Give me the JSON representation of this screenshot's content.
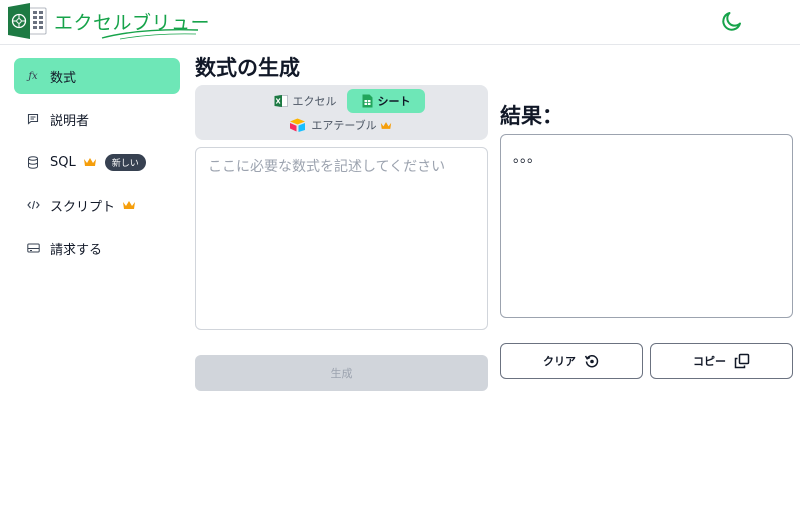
{
  "header": {
    "app_name": "エクセルブリュー",
    "theme_toggle_icon": "moon-icon",
    "brand_color": "#16a34a"
  },
  "sidebar": {
    "items": [
      {
        "label": "数式",
        "icon": "function-icon",
        "active": true
      },
      {
        "label": "説明者",
        "icon": "message-icon"
      },
      {
        "label": "SQL",
        "icon": "database-icon",
        "premium": true,
        "badge": "新しい"
      },
      {
        "label": "スクリプト",
        "icon": "code-icon",
        "premium": true
      },
      {
        "label": "請求する",
        "icon": "billing-icon"
      }
    ]
  },
  "main": {
    "title": "数式の生成",
    "tabs": [
      {
        "label": "エクセル",
        "icon": "excel-icon"
      },
      {
        "label": "シート",
        "icon": "sheets-icon",
        "active": true
      },
      {
        "label": "エアテーブル",
        "icon": "airtable-icon",
        "premium": true
      }
    ],
    "input": {
      "placeholder": "ここに必要な数式を記述してください",
      "value": ""
    },
    "generate_label": "生成"
  },
  "result": {
    "title": "結果：",
    "content": "。。。",
    "clear_label": "クリア",
    "copy_label": "コピー"
  },
  "colors": {
    "accent": "#6ee7b7",
    "crown": "#f59e0b",
    "disabled": "#d1d5db"
  }
}
